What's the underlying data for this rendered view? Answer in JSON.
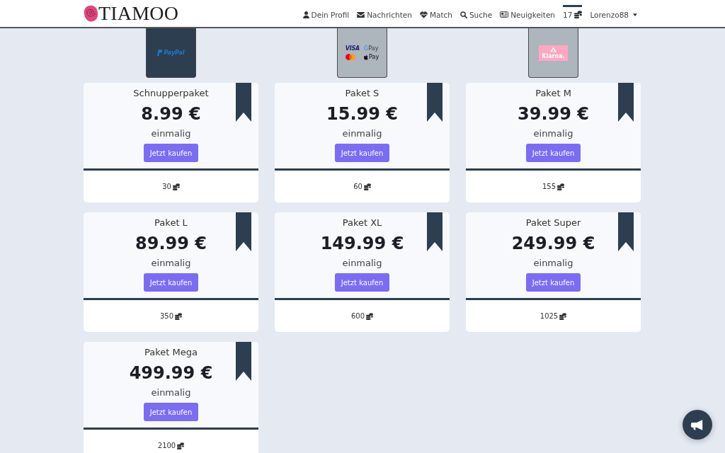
{
  "navbar": {
    "brand": {
      "name": "TIAMOO"
    },
    "items": [
      {
        "kind": "profile",
        "label": "Dein Profil",
        "selected": false
      },
      {
        "kind": "messages",
        "label": "Nachrichten",
        "selected": false
      },
      {
        "kind": "match",
        "label": "Match",
        "selected": false
      },
      {
        "kind": "search",
        "label": "Suche",
        "selected": false
      },
      {
        "kind": "news",
        "label": "Neuigkeiten",
        "selected": false
      },
      {
        "kind": "balance",
        "label": "17",
        "selected": true
      },
      {
        "kind": "account",
        "label": "Lorenzo88",
        "selected": false
      }
    ]
  },
  "payment_methods": [
    {
      "kind": "paypal",
      "selected": true,
      "labels": [
        "PayPal"
      ]
    },
    {
      "kind": "cards",
      "selected": false,
      "labels": [
        "VISA",
        "GPay",
        "Pay"
      ]
    },
    {
      "kind": "klarna",
      "selected": false,
      "labels": [
        "Klarna."
      ]
    }
  ],
  "packages": [
    {
      "name": "Schnupperpaket",
      "price": "8.99 €",
      "billing": "einmalig",
      "button": "Jetzt kaufen",
      "coins": "30"
    },
    {
      "name": "Paket S",
      "price": "15.99 €",
      "billing": "einmalig",
      "button": "Jetzt kaufen",
      "coins": "60"
    },
    {
      "name": "Paket M",
      "price": "39.99 €",
      "billing": "einmalig",
      "button": "Jetzt kaufen",
      "coins": "155"
    },
    {
      "name": "Paket L",
      "price": "89.99 €",
      "billing": "einmalig",
      "button": "Jetzt kaufen",
      "coins": "350"
    },
    {
      "name": "Paket XL",
      "price": "149.99 €",
      "billing": "einmalig",
      "button": "Jetzt kaufen",
      "coins": "600"
    },
    {
      "name": "Paket Super",
      "price": "249.99 €",
      "billing": "einmalig",
      "button": "Jetzt kaufen",
      "coins": "1025"
    },
    {
      "name": "Paket Mega",
      "price": "499.99 €",
      "billing": "einmalig",
      "button": "Jetzt kaufen",
      "coins": "2100"
    }
  ]
}
